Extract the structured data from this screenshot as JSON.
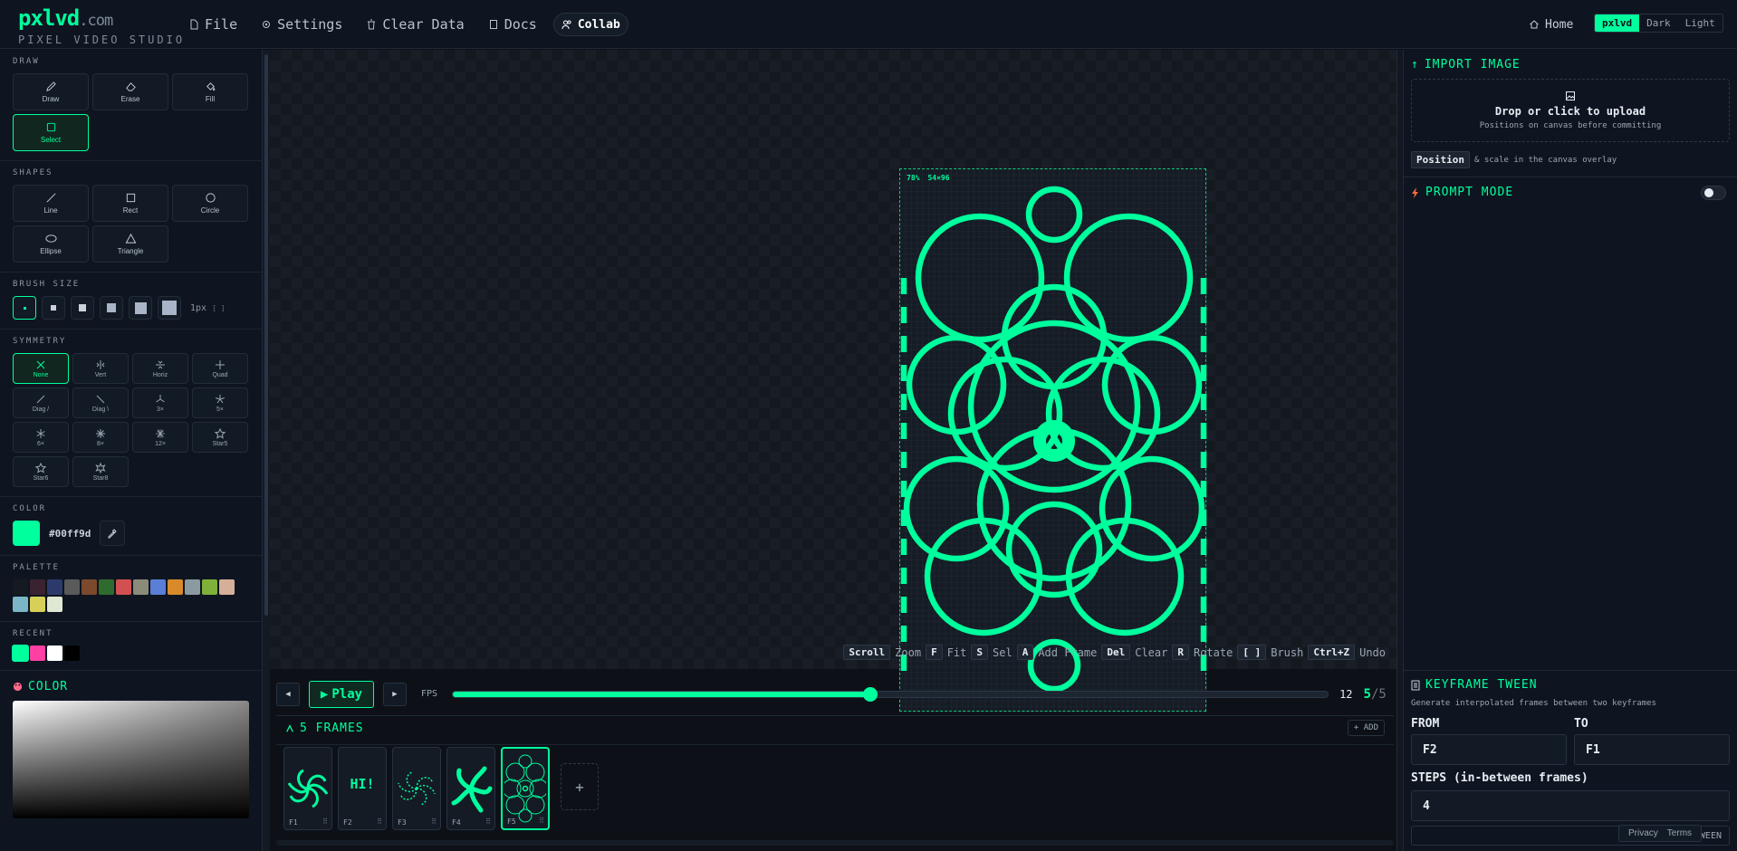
{
  "app": {
    "logo": "pxlvd",
    "logo_suffix": ".com",
    "subtitle": "PIXEL VIDEO STUDIO"
  },
  "nav": {
    "file": "File",
    "settings": "Settings",
    "clear_data": "Clear Data",
    "docs": "Docs",
    "collab": "Collab",
    "home": "Home"
  },
  "theme": {
    "options": [
      "pxlvd",
      "Dark",
      "Light"
    ],
    "active": "pxlvd"
  },
  "left": {
    "draw_title": "DRAW",
    "draw_tools": [
      "Draw",
      "Erase",
      "Fill",
      "Select"
    ],
    "shapes_title": "SHAPES",
    "shapes": [
      "Line",
      "Rect",
      "Circle",
      "Ellipse",
      "Triangle"
    ],
    "brush_title": "BRUSH SIZE",
    "brush_size_label": "1px",
    "brush_hint": "[ ]",
    "symmetry_title": "SYMMETRY",
    "symmetry": [
      "None",
      "Vert",
      "Horiz",
      "Quad",
      "Diag /",
      "Diag \\",
      "3×",
      "5×",
      "6×",
      "8×",
      "12×",
      "Star5",
      "Star6",
      "Star8"
    ],
    "color_title": "COLOR",
    "color_hex": "#00ff9d",
    "palette_title": "PALETTE",
    "palette": [
      "#141922",
      "#3b2230",
      "#2c3a6b",
      "#5a5a5a",
      "#7b4a2c",
      "#2f6b2f",
      "#d35050",
      "#8b8b7a",
      "#5b7fd6",
      "#d98a2b",
      "#8b9aa0",
      "#7fb03a",
      "#d4b09a",
      "#7ab6c6",
      "#d8cf59",
      "#dfe8d2"
    ],
    "recent_title": "RECENT",
    "recent": [
      "#00ff9d",
      "#ff3fa4",
      "#ffffff",
      "#000000"
    ],
    "picker_title": "COLOR"
  },
  "canvas": {
    "zoom": "78%",
    "dims": "54×96",
    "accent": "#00ff9d"
  },
  "shortcuts": [
    {
      "key": "Scroll",
      "label": "Zoom"
    },
    {
      "key": "F",
      "label": "Fit"
    },
    {
      "key": "S",
      "label": "Sel"
    },
    {
      "key": "A",
      "label": "Add Frame"
    },
    {
      "key": "Del",
      "label": "Clear"
    },
    {
      "key": "R",
      "label": "Rotate"
    },
    {
      "key": "[ ]",
      "label": "Brush"
    },
    {
      "key": "Ctrl+Z",
      "label": "Undo"
    }
  ],
  "playback": {
    "play_label": "Play",
    "fps_label": "FPS",
    "fps_value": "12",
    "fps_fraction": 0.477,
    "current_frame": "5",
    "total_frames": "/5"
  },
  "frames": {
    "title": "5 FRAMES",
    "add_label": "+ ADD",
    "items": [
      "F1",
      "F2",
      "F3",
      "F4",
      "F5"
    ],
    "f2_text": "HI!",
    "active": "F5"
  },
  "right": {
    "import_title": "IMPORT IMAGE",
    "upload_title": "Drop or click to upload",
    "upload_sub": "Positions on canvas before committing",
    "position_key": "Position",
    "position_hint": "& scale in the canvas overlay",
    "prompt_title": "PROMPT MODE",
    "keyframe_title": "KEYFRAME TWEEN",
    "keyframe_sub": "Generate interpolated frames between two keyframes",
    "from_label": "FROM",
    "from_value": "F2",
    "to_label": "TO",
    "to_value": "F1",
    "steps_label": "STEPS (in-between frames)",
    "steps_value": "4",
    "generate_label": "GENERATE TWEEN"
  },
  "footer": {
    "privacy": "Privacy",
    "terms": "Terms"
  }
}
